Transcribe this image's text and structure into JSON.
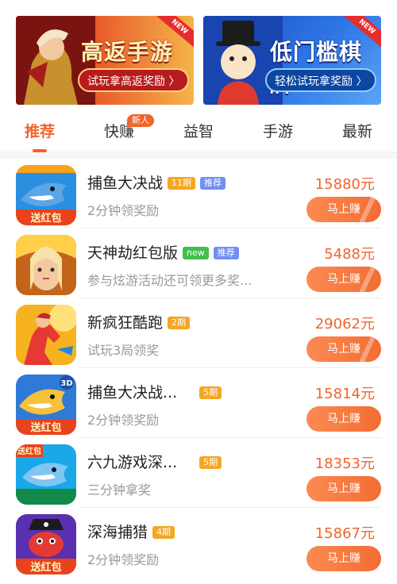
{
  "banners": [
    {
      "title": "高返手游",
      "cta": "试玩拿高返奖励 〉",
      "ribbon": "NEW"
    },
    {
      "title": "低门槛棋牌",
      "cta": "轻松试玩拿奖励 〉",
      "ribbon": "NEW"
    }
  ],
  "tabs": [
    {
      "label": "推荐",
      "active": true
    },
    {
      "label": "快赚",
      "badge": "新人"
    },
    {
      "label": "益智"
    },
    {
      "label": "手游"
    },
    {
      "label": "最新"
    }
  ],
  "games": [
    {
      "name": "捕鱼大决战",
      "tags": [
        {
          "text": "11期",
          "color": "orange"
        },
        {
          "text": "推荐",
          "color": "blue"
        }
      ],
      "desc": "2分钟领奖励",
      "price": "15880元",
      "button": "马上赚",
      "icon": "fishing-shark-icon"
    },
    {
      "name": "天神劫红包版",
      "tags": [
        {
          "text": "new",
          "color": "green"
        },
        {
          "text": "推荐",
          "color": "blue"
        }
      ],
      "desc": "参与炫游活动还可领更多奖...",
      "price": "5488元",
      "button": "马上赚",
      "icon": "warrior-portrait-icon"
    },
    {
      "name": "新疯狂酷跑",
      "tags": [
        {
          "text": "2期",
          "color": "orange"
        }
      ],
      "desc": "试玩3局领奖",
      "price": "29062元",
      "button": "马上赚",
      "icon": "runner-icon"
    },
    {
      "name": "捕鱼大决战...",
      "tags": [
        {
          "text": "5期",
          "color": "orange"
        }
      ],
      "desc": "2分钟领奖励",
      "price": "15814元",
      "button": "马上赚",
      "icon": "fishing-3d-icon"
    },
    {
      "name": "六九游戏深...",
      "tags": [
        {
          "text": "5期",
          "color": "orange"
        }
      ],
      "desc": "三分钟拿奖",
      "price": "18353元",
      "button": "马上赚",
      "icon": "shark-redpacket-icon"
    },
    {
      "name": "深海捕猎",
      "tags": [
        {
          "text": "4期",
          "color": "orange"
        }
      ],
      "desc": "2分钟领奖励",
      "price": "15867元",
      "button": "马上赚",
      "icon": "pirate-crab-icon"
    }
  ],
  "icon_labels": {
    "red_packet": "送红包",
    "three_d": "3D"
  },
  "colors": {
    "accent": "#f2642c",
    "price": "#f2642c",
    "tag_orange": "#f5a623",
    "tag_blue": "#6f8ff3",
    "tag_green": "#42c04a"
  }
}
